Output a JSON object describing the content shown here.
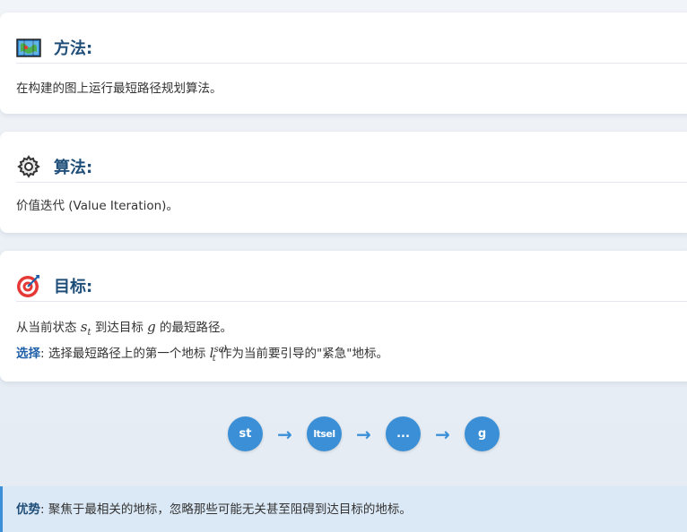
{
  "cards": [
    {
      "title": "方法:",
      "icon": "map-icon",
      "body": "在构建的图上运行最短路径规划算法。"
    },
    {
      "title": "算法:",
      "icon": "gear-icon",
      "body": "价值迭代 (Value Iteration)。"
    },
    {
      "title": "目标:",
      "icon": "target-icon",
      "line1_pre": "从当前状态 ",
      "line1_var": "s",
      "line1_sub": "t",
      "line1_mid": " 到达目标 ",
      "line1_g": "g",
      "line1_post": " 的最短路径。",
      "line2_label": "选择",
      "line2_pre": ": 选择最短路径上的第一个地标 ",
      "line2_var": "l",
      "line2_sup": "sel",
      "line2_sub": "t",
      "line2_post": " 作为当前要引导的\"紧急\"地标。"
    }
  ],
  "flow": [
    "st",
    "ltsel",
    "...",
    "g"
  ],
  "arrow": "→",
  "advantage": {
    "label": "优势",
    "text": ": 聚焦于最相关的地标，忽略那些可能无关甚至阻碍到达目标的地标。"
  }
}
